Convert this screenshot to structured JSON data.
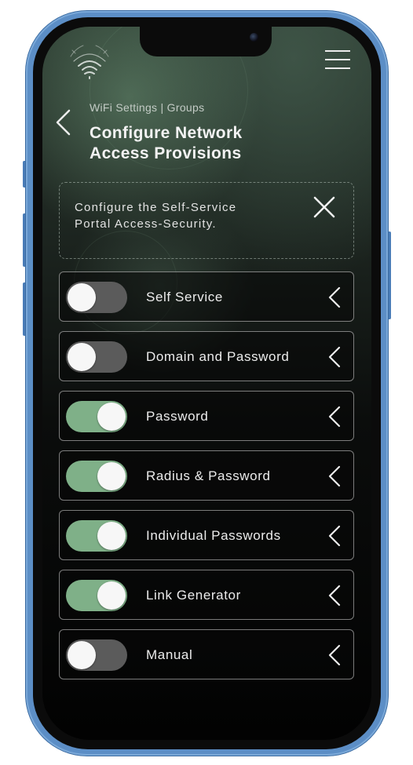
{
  "header": {
    "logo_icon": "wifi-signal-logo",
    "menu_icon": "hamburger-menu-icon",
    "back_icon": "chevron-left-icon",
    "breadcrumb": "WiFi Settings | Groups",
    "title_lines": [
      "Configure Network",
      "Access Provisions"
    ]
  },
  "info_card": {
    "lines": [
      "Configure the Self-Service",
      "Portal Access-Security."
    ],
    "close_icon": "close-x-icon"
  },
  "options": [
    {
      "label": "Self Service",
      "enabled": false
    },
    {
      "label": "Domain and Password",
      "enabled": false
    },
    {
      "label": "Password",
      "enabled": true
    },
    {
      "label": "Radius & Password",
      "enabled": true
    },
    {
      "label": "Individual Passwords",
      "enabled": true
    },
    {
      "label": "Link Generator",
      "enabled": true
    },
    {
      "label": "Manual",
      "enabled": false
    }
  ],
  "colors": {
    "toggle_on": "#7fb088",
    "toggle_off": "#5b5b5b",
    "phone_frame": "#5c8ec6"
  }
}
